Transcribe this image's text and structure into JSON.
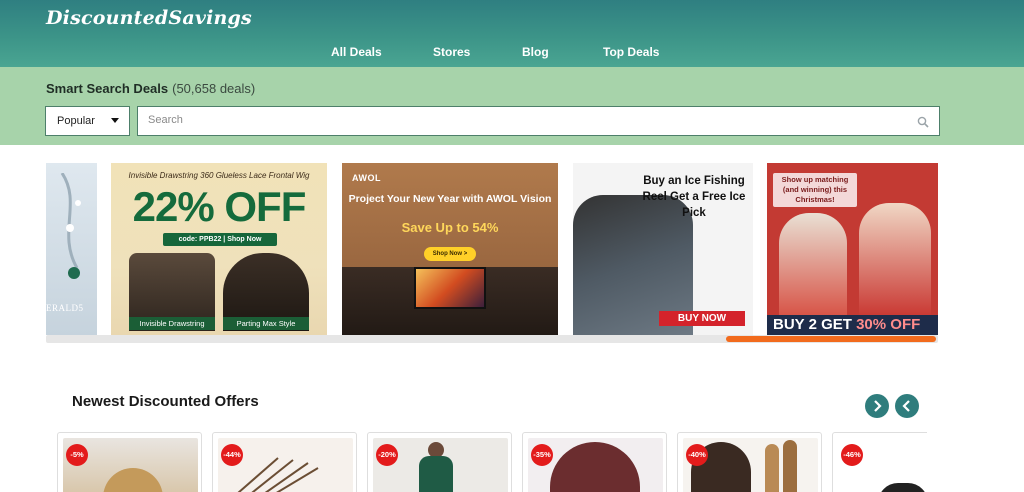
{
  "header": {
    "logo": "DiscountedSavings",
    "nav": [
      "All Deals",
      "Stores",
      "Blog",
      "Top Deals"
    ]
  },
  "search": {
    "title": "Smart Search Deals",
    "count": "(50,658 deals)",
    "sort_value": "Popular",
    "placeholder": "Search"
  },
  "banners": {
    "b1_text": "ERALD5",
    "b2_top": "Invisible Drawstring 360 Glueless Lace Frontal Wig",
    "b2_big": "22% OFF",
    "b2_code": "code: PPB22  | Shop Now",
    "b2_label1": "Invisible Drawstring",
    "b2_label2": "Parting Max Style",
    "b3_logo": "AWOL",
    "b3_h1": "Project Your New Year with AWOL Vision",
    "b3_h2": "Save Up to 54%",
    "b3_btn": "Shop Now >",
    "b4_h1": "Buy an Ice Fishing Reel Get a Free Ice Pick",
    "b4_btn": "BUY NOW",
    "b5_note": "Show up matching (and winning) this Christmas!",
    "b5_foot_a": "BUY 2 GET ",
    "b5_foot_b": "30% OFF"
  },
  "offers": {
    "title": "Newest Discounted Offers",
    "badges": [
      "-5%",
      "-44%",
      "-20%",
      "-35%",
      "-40%",
      "-46%"
    ]
  },
  "colors": {
    "header": "#3c9488",
    "search_band": "#a7d3aa",
    "arrow": "#2f7d7d",
    "badge": "#e31b1b",
    "scroll_thumb": "#f26b1d"
  }
}
